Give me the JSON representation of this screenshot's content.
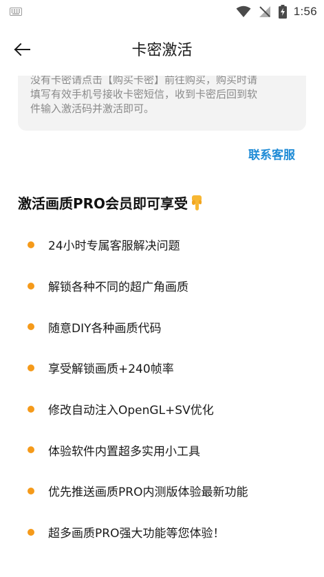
{
  "status_bar": {
    "time": "1:56",
    "icons": [
      "keyboard-icon",
      "wifi-icon",
      "no-signal-icon",
      "battery-charging-icon"
    ]
  },
  "app_bar": {
    "title": "卡密激活",
    "back_icon": "arrow-left-icon"
  },
  "notice": {
    "lines": [
      "没有卡密请点击【购买卡密】前往购买，购买时请",
      "填写有效手机号接收卡密短信，收到卡密后回到软",
      "件输入激活码并激活即可。"
    ]
  },
  "service_link": "联系客服",
  "benefits": {
    "title": "激活画质PRO会员即可享受",
    "title_icon": "pointing-down-hand-icon",
    "items": [
      "24小时专属客服解决问题",
      "解锁各种不同的超广角画质",
      "随意DIY各种画质代码",
      "享受解锁画质+240帧率",
      "修改自动注入OpenGL+SV优化",
      "体验软件内置超多实用小工具",
      "优先推送画质PRO内测版体验最新功能",
      "超多画质PRO强大功能等您体验！"
    ]
  },
  "colors": {
    "bullet": "#f59a1a",
    "link": "#1e8bd6",
    "card_bg": "#f3f3f3",
    "hand": "#f7b733"
  }
}
